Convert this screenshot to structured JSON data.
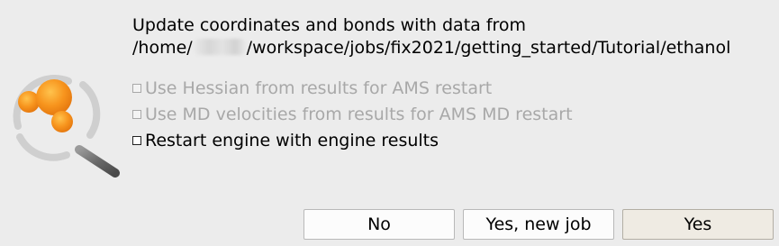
{
  "message": {
    "line1": "Update coordinates and bonds with data from",
    "path_prefix": "/home/",
    "path_suffix": "/workspace/jobs/fix2021/getting_started/Tutorial/ethanol"
  },
  "options": [
    {
      "label": "Use Hessian from results for AMS restart",
      "enabled": false,
      "checked": false
    },
    {
      "label": "Use MD velocities from results for AMS MD restart",
      "enabled": false,
      "checked": false
    },
    {
      "label": "Restart engine with engine results",
      "enabled": true,
      "checked": false
    }
  ],
  "buttons": {
    "no": "No",
    "new_job": "Yes, new job",
    "yes": "Yes"
  },
  "icon": "magnifier-molecule-icon",
  "colors": {
    "background": "#ececec",
    "disabled_text": "#a8a8a8",
    "atom_orange": "#f7941d",
    "default_button": "#efebe3"
  }
}
